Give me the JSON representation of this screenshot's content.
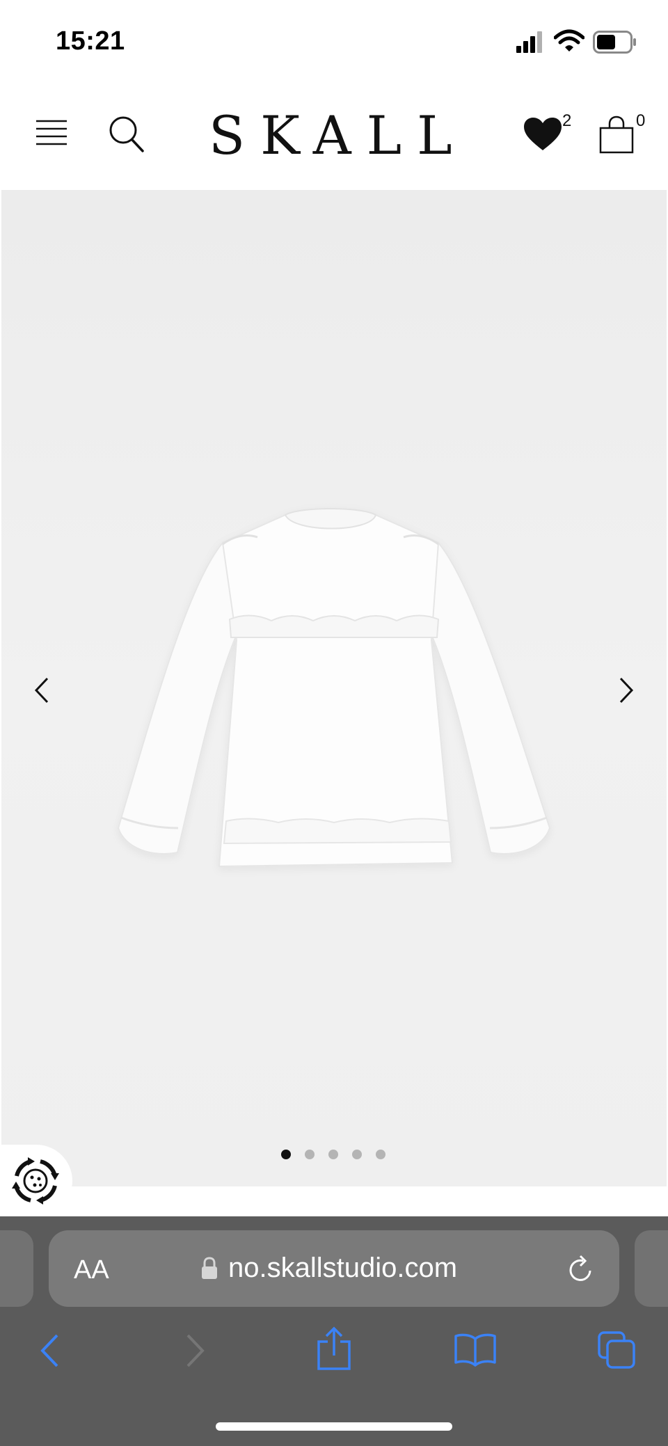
{
  "status_bar": {
    "time": "15:21"
  },
  "header": {
    "logo": "SKALL",
    "wishlist_count": "2",
    "cart_count": "0"
  },
  "gallery": {
    "total_images": 5,
    "active_index": 0
  },
  "browser": {
    "text_size_label": "AA",
    "url": "no.skallstudio.com"
  },
  "colors": {
    "accent": "#3b82f6",
    "toolbar_bg": "#5b5b5b",
    "url_pill_bg": "#7a7a7a"
  }
}
